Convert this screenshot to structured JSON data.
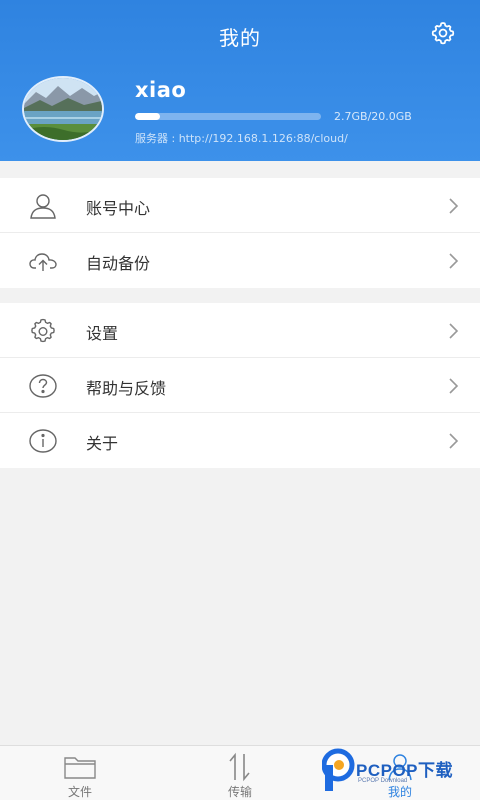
{
  "header": {
    "title": "我的",
    "settings_icon": "gear-icon"
  },
  "profile": {
    "username": "xiao",
    "storage_used_fraction": 0.135,
    "storage_text": "2.7GB/20.0GB",
    "server_text": "服务器 : http://192.168.1.126:88/cloud/"
  },
  "menu_group_1": [
    {
      "label": "账号中心",
      "icon": "user-icon"
    },
    {
      "label": "自动备份",
      "icon": "cloud-upload-icon"
    }
  ],
  "menu_group_2": [
    {
      "label": "设置",
      "icon": "gear-icon"
    },
    {
      "label": "帮助与反馈",
      "icon": "help-icon"
    },
    {
      "label": "关于",
      "icon": "info-icon"
    }
  ],
  "tabbar": {
    "tabs": [
      {
        "label": "文件",
        "icon": "folder-icon"
      },
      {
        "label": "传输",
        "icon": "transfer-icon"
      },
      {
        "label": "我的",
        "icon": "user-icon",
        "active": true
      }
    ]
  },
  "watermark": {
    "text": "PCPOP下载",
    "subtext": "PCPOP Download"
  },
  "colors": {
    "accent": "#2f83e0",
    "background": "#f2f2f2"
  }
}
